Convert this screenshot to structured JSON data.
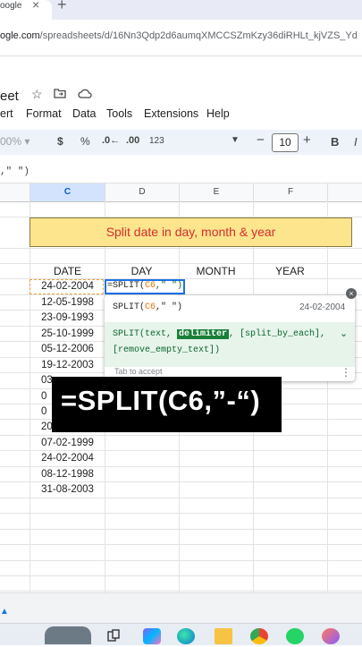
{
  "browser": {
    "tab_title": "oogle",
    "tab_close": "×",
    "new_tab": "+",
    "url_domain": "ogle.com",
    "url_path": "/spreadsheets/d/16Nn3Qdp2d6aumqXMCCSZmKzy36diRHLt_kjVZS_Yd"
  },
  "sheets": {
    "doc_name": "eet",
    "menu": [
      "ert",
      "Format",
      "Data",
      "Tools",
      "Extensions",
      "Help"
    ],
    "toolbar": {
      "zoom": "00%",
      "currency": "$",
      "percent": "%",
      "dec_decrease": ".0←",
      "dec_increase": ".00",
      "number_format": "123",
      "font_size": "10",
      "minus": "−",
      "plus": "+",
      "bold": "B",
      "italic": "I"
    },
    "formula_bar_text": ",\" \")"
  },
  "grid": {
    "columns": [
      "C",
      "D",
      "E",
      "F"
    ],
    "title": "Split date in day, month & year",
    "headers": [
      "DATE",
      "DAY",
      "MONTH",
      "YEAR"
    ],
    "dates": [
      "24-02-2004",
      "12-05-1998",
      "23-09-1993",
      "25-10-1999",
      "05-12-2006",
      "19-12-2003",
      "03",
      "0",
      "0",
      "20",
      "07-02-1999",
      "24-02-2004",
      "08-12-1998",
      "31-08-2003"
    ],
    "active_cell_text": {
      "prefix": "=SPLIT(",
      "ref": "C6",
      "suffix": ",\" \")"
    }
  },
  "autocomplete": {
    "formula_prefix": "SPLIT(",
    "formula_ref": "C6",
    "formula_suffix": ",\" \")",
    "preview_value": "24-02-2004",
    "signature_start": "SPLIT(text, ",
    "signature_highlight": "delimiter",
    "signature_end": ", [split_by_each],",
    "signature_line2": "[remove_empty_text])",
    "hint": "Tab  to accept",
    "close": "×",
    "more": "⋮",
    "chevron": "⌄"
  },
  "overlay": {
    "text": "=SPLIT(C6,”-“)"
  }
}
